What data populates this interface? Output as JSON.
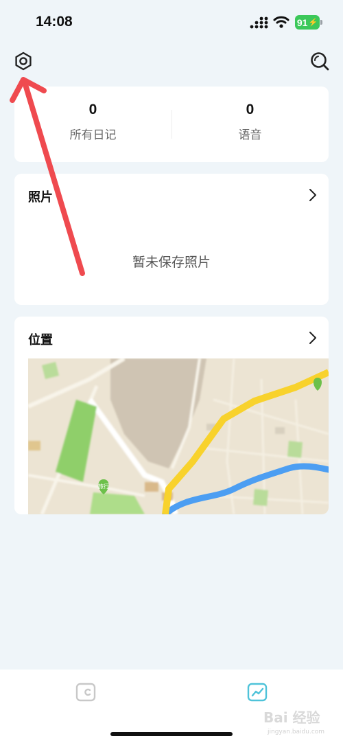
{
  "status_bar": {
    "time": "14:08",
    "battery": "91"
  },
  "stats": [
    {
      "value": "0",
      "label": "所有日记"
    },
    {
      "value": "0",
      "label": "语音"
    }
  ],
  "photos": {
    "title": "照片",
    "empty_text": "暂未保存照片"
  },
  "location": {
    "title": "位置"
  },
  "map_labels": {
    "poi_1": "旅行"
  },
  "watermark": {
    "main": "Bai 经验",
    "sub": "jingyan.baidu.com"
  },
  "icons": {
    "settings": "settings-icon",
    "search": "search-icon",
    "chevron": "chevron-right-icon",
    "tab_diary": "diary-tab-icon",
    "tab_stats": "stats-tab-icon"
  },
  "colors": {
    "background": "#eff5f9",
    "card": "#ffffff",
    "active_tab": "#4fc3d9",
    "annotation_arrow": "#ef4a4f",
    "battery": "#3cc85a"
  }
}
